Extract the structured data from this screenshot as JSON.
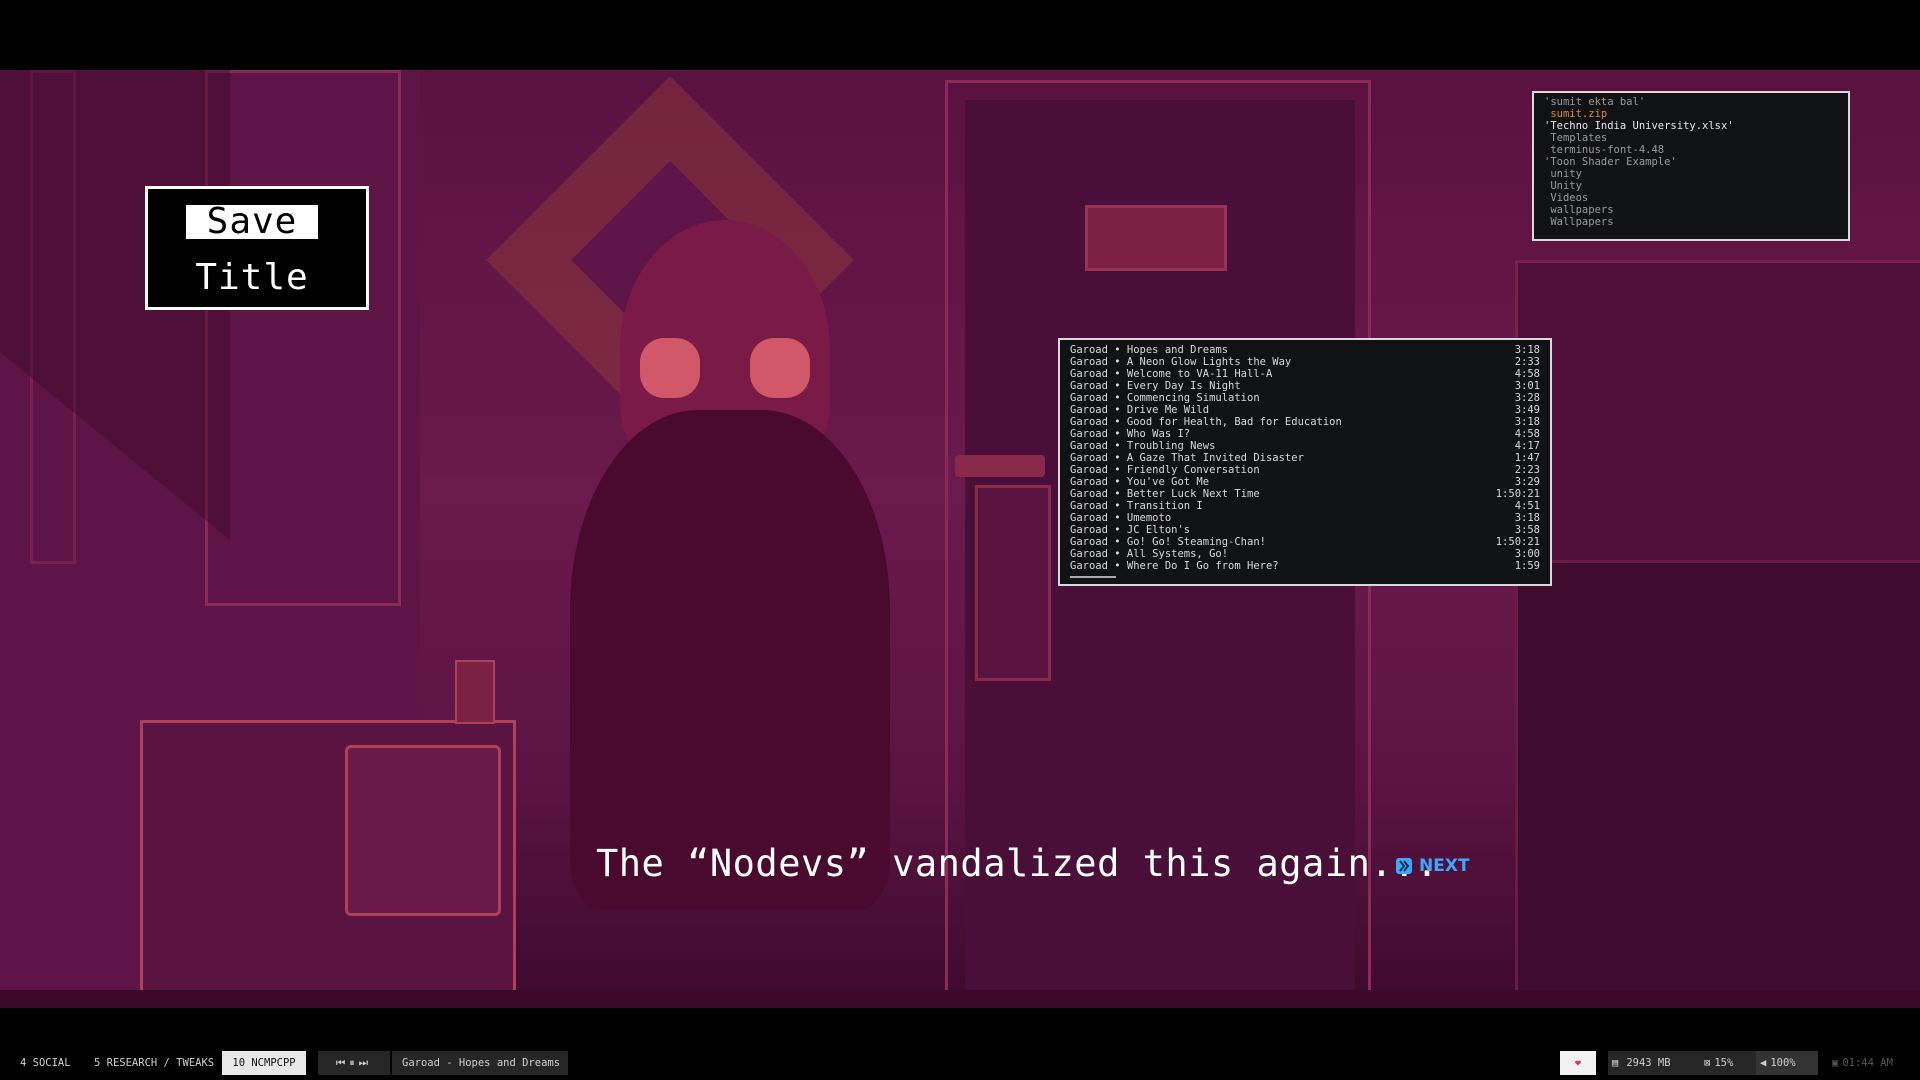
{
  "menu": {
    "items": [
      "Save",
      "Title"
    ],
    "selected_index": 0
  },
  "file_terminal": {
    "rows": [
      {
        "text": "'sumit ekta bal'",
        "color": "gray"
      },
      {
        "text": " sumit.zip",
        "color": "orange"
      },
      {
        "text": "'Techno India University.xlsx'",
        "color": "white"
      },
      {
        "text": " Templates",
        "color": "gray"
      },
      {
        "text": " terminus-font-4.48",
        "color": "gray"
      },
      {
        "text": "'Toon Shader Example'",
        "color": "gray"
      },
      {
        "text": " unity",
        "color": "gray"
      },
      {
        "text": " Unity",
        "color": "gray"
      },
      {
        "text": " Videos",
        "color": "gray"
      },
      {
        "text": " wallpapers",
        "color": "gray"
      },
      {
        "text": " Wallpapers",
        "color": "gray"
      }
    ]
  },
  "playlist": {
    "tracks": [
      {
        "title": "Garoad • Hopes and Dreams",
        "duration": "3:18"
      },
      {
        "title": "Garoad • A Neon Glow Lights the Way",
        "duration": "2:33"
      },
      {
        "title": "Garoad • Welcome to VA-11 Hall-A",
        "duration": "4:58"
      },
      {
        "title": "Garoad • Every Day Is Night",
        "duration": "3:01"
      },
      {
        "title": "Garoad • Commencing Simulation",
        "duration": "3:28"
      },
      {
        "title": "Garoad • Drive Me Wild",
        "duration": "3:49"
      },
      {
        "title": "Garoad • Good for Health, Bad for Education",
        "duration": "3:18"
      },
      {
        "title": "Garoad • Who Was I?",
        "duration": "4:58"
      },
      {
        "title": "Garoad • Troubling News",
        "duration": "4:17"
      },
      {
        "title": "Garoad • A Gaze That Invited Disaster",
        "duration": "1:47"
      },
      {
        "title": "Garoad • Friendly Conversation",
        "duration": "2:23"
      },
      {
        "title": "Garoad • You've Got Me",
        "duration": "3:29"
      },
      {
        "title": "Garoad • Better Luck Next Time",
        "duration": "1:50:21"
      },
      {
        "title": "Garoad • Transition I",
        "duration": "4:51"
      },
      {
        "title": "Garoad • Umemoto",
        "duration": "3:18"
      },
      {
        "title": "Garoad • JC Elton's",
        "duration": "3:58"
      },
      {
        "title": "Garoad • Go! Go! Steaming-Chan!",
        "duration": "1:50:21"
      },
      {
        "title": "Garoad • All Systems, Go!",
        "duration": "3:00"
      },
      {
        "title": "Garoad • Where Do I Go from Here?",
        "duration": "1:59"
      }
    ]
  },
  "dialogue": {
    "text": "The “Nodevs” vandalized this again...",
    "next_label": "NEXT",
    "next_icon": "next-arrow-icon",
    "next_color": "#3aa8ff"
  },
  "taskbar": {
    "workspaces": [
      {
        "label": "4 SOCIAL",
        "active": false
      },
      {
        "label": "5 RESEARCH / TWEAKS",
        "active": false
      },
      {
        "label": "10 NCMPCPP",
        "active": true
      }
    ],
    "media_controls": {
      "prev": "⏮",
      "pause": "⏸",
      "next": "⏭"
    },
    "now_playing": "Garoad - Hopes and Dreams",
    "heart_icon": "heart-icon",
    "heart_glyph": "❤",
    "heart_color": "#e0305a",
    "memory": "2943 MB",
    "memory_icon": "memory-icon",
    "cpu": "15%",
    "cpu_icon": "cpu-icon",
    "volume": "100%",
    "volume_icon": "speaker-icon",
    "clock": "01:44 AM",
    "clock_icon": "clock-icon"
  }
}
